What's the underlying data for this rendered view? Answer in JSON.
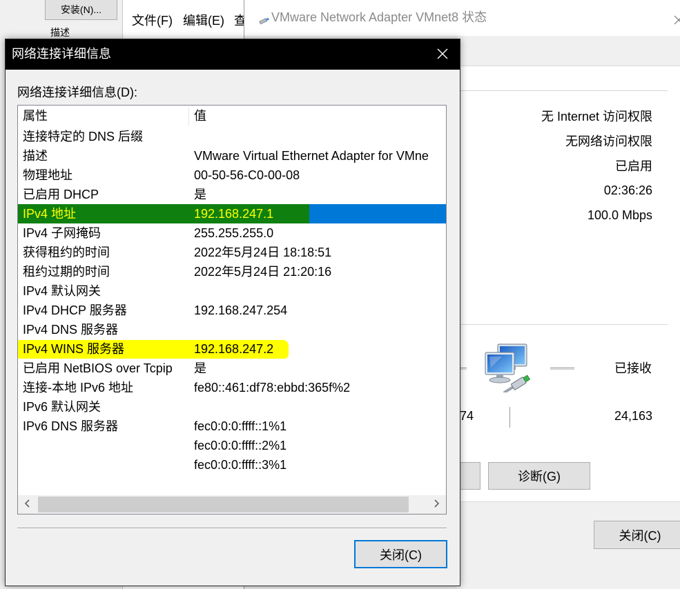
{
  "background_windows": {
    "install_button": "安装(N)...",
    "description_label": "描述",
    "menu": {
      "file": "文件(F)",
      "edit": "编辑(E)",
      "view_partial": "查"
    }
  },
  "status_window": {
    "title": "VMware Network Adapter VMnet8 状态",
    "connection": {
      "ipv4_connectivity": "无 Internet 访问权限",
      "ipv6_connectivity": "无网络访问权限",
      "media_state": "已启用",
      "duration": "02:36:26",
      "speed": "100.0 Mbps"
    },
    "activity": {
      "received_label": "已接收",
      "sent_bytes_partial": "74",
      "received_bytes": "24,163"
    },
    "diagnose_button": "诊断(G)",
    "close_button": "关闭(C)"
  },
  "details_dialog": {
    "title": "网络连接详细信息",
    "list_label": "网络连接详细信息(D):",
    "columns": {
      "property": "属性",
      "value": "值"
    },
    "rows": [
      {
        "property": "连接特定的 DNS 后缀",
        "value": ""
      },
      {
        "property": "描述",
        "value": "VMware Virtual Ethernet Adapter for VMne"
      },
      {
        "property": "物理地址",
        "value": "00-50-56-C0-00-08"
      },
      {
        "property": "已启用 DHCP",
        "value": "是"
      },
      {
        "property": "IPv4 地址",
        "value": "192.168.247.1"
      },
      {
        "property": "IPv4 子网掩码",
        "value": "255.255.255.0"
      },
      {
        "property": "获得租约的时间",
        "value": "2022年5月24日 18:18:51"
      },
      {
        "property": "租约过期的时间",
        "value": "2022年5月24日 21:20:16"
      },
      {
        "property": "IPv4 默认网关",
        "value": ""
      },
      {
        "property": "IPv4 DHCP 服务器",
        "value": "192.168.247.254"
      },
      {
        "property": "IPv4 DNS 服务器",
        "value": ""
      },
      {
        "property": "IPv4 WINS 服务器",
        "value": "192.168.247.2"
      },
      {
        "property": "已启用 NetBIOS over Tcpip",
        "value": "是"
      },
      {
        "property": "连接-本地 IPv6 地址",
        "value": "fe80::461:df78:ebbd:365f%2"
      },
      {
        "property": "IPv6 默认网关",
        "value": ""
      },
      {
        "property": "IPv6 DNS 服务器",
        "value": "fec0:0:0:ffff::1%1"
      },
      {
        "property": "",
        "value": "fec0:0:0:ffff::2%1"
      },
      {
        "property": "",
        "value": "fec0:0:0:ffff::3%1"
      }
    ],
    "selected_row": 4,
    "highlights": [
      {
        "row": 4,
        "color": "#0f800f",
        "text_color": "#ffff00"
      },
      {
        "row": 11,
        "color": "#ffff00"
      }
    ],
    "close_button": "关闭(C)"
  },
  "icons": {
    "status_title": "network-adapter-icon",
    "status_close": "close-icon",
    "dialog_close": "close-icon",
    "activity": "network-computers-icon",
    "scroll_left": "chevron-left-icon",
    "scroll_right": "chevron-right-icon"
  },
  "colors": {
    "selection": "#0078d7",
    "dialog_titlebar": "#000000",
    "dialog_title_text": "#ffffff",
    "default_button_border": "#0078d7"
  }
}
